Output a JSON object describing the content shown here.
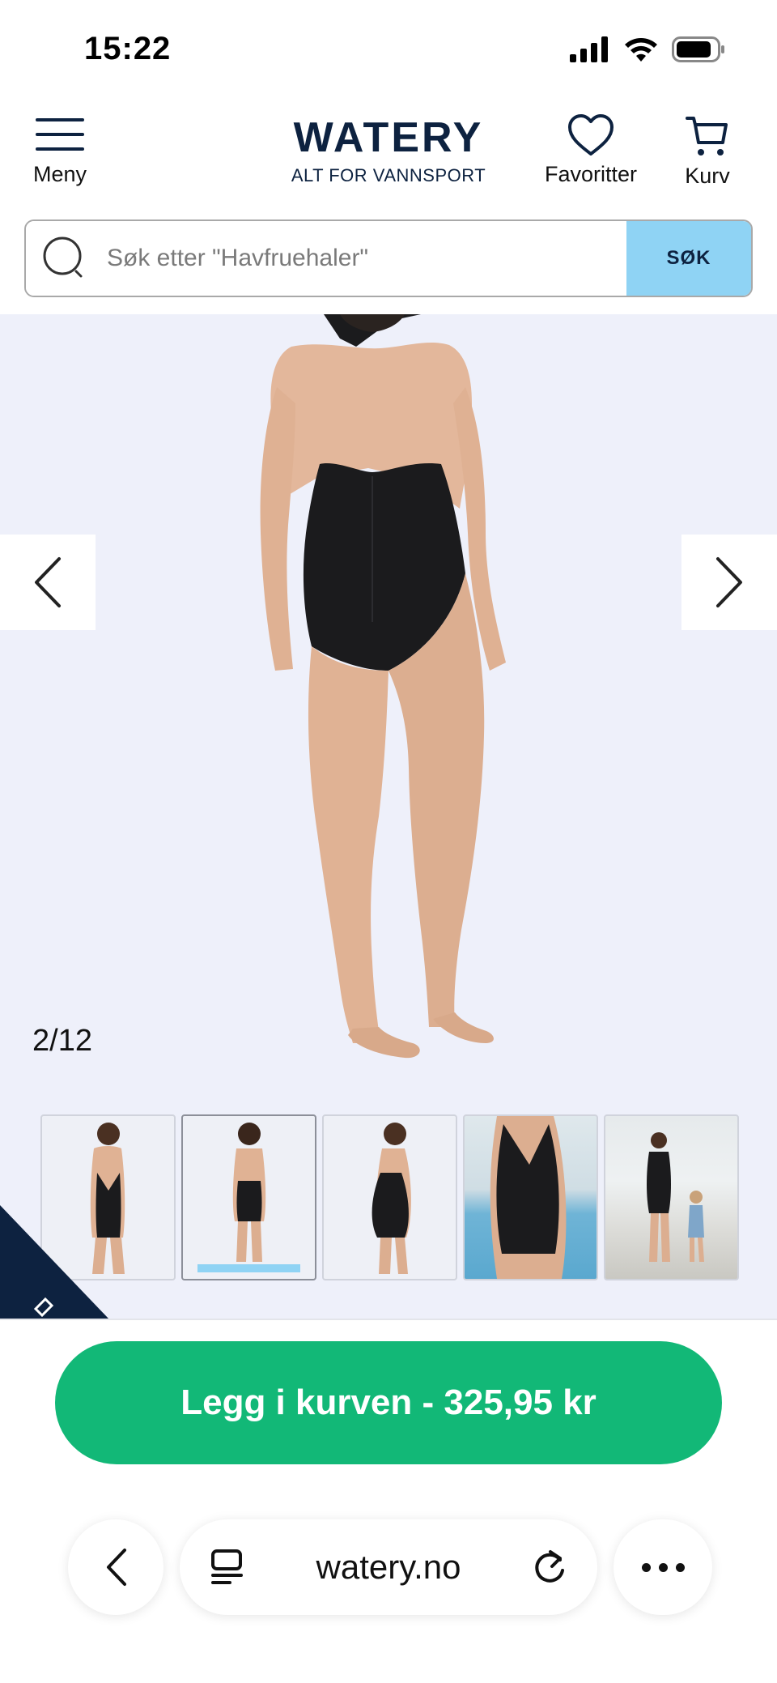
{
  "status_bar": {
    "time": "15:22",
    "icons": [
      "signal-icon",
      "wifi-icon",
      "battery-icon"
    ]
  },
  "header": {
    "menu_label": "Meny",
    "logo_main": "WATERY",
    "logo_sub": "ALT FOR VANNSPORT",
    "favorites_label": "Favoritter",
    "cart_label": "Kurv",
    "brand_color": "#0d2240"
  },
  "search": {
    "placeholder": "Søk etter \"Havfruehaler\"",
    "button_label": "SØK",
    "button_color": "#8fd3f4"
  },
  "gallery": {
    "counter": "2/12",
    "current_index": 2,
    "total": 12,
    "thumbnails": [
      {
        "name": "front-view"
      },
      {
        "name": "back-view",
        "active": true
      },
      {
        "name": "side-view"
      },
      {
        "name": "pool-closeup"
      },
      {
        "name": "pool-hall-with-child"
      }
    ]
  },
  "cta": {
    "label": "Legg i kurven - 325,95 kr",
    "color": "#12b877"
  },
  "browser": {
    "url": "watery.no"
  }
}
